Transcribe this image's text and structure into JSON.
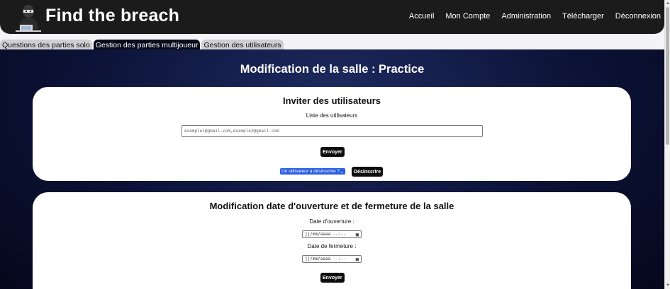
{
  "header": {
    "brand": "Find the breach",
    "nav": [
      "Accueil",
      "Mon Compte",
      "Administration",
      "Télécharger",
      "Déconnexion"
    ]
  },
  "tabs": [
    {
      "label": "Questions des parties solo",
      "active": false
    },
    {
      "label": "Gestion des parties multijoueur",
      "active": true
    },
    {
      "label": "Gestion des utilisateurs",
      "active": false
    }
  ],
  "page_title": "Modification de la salle : Practice",
  "invite": {
    "title": "Inviter des utilisateurs",
    "users_label": "Liste des utilisateurs",
    "users_placeholder": "example1@gmail.com,example2@gmail.com",
    "send_label": "Envoyer",
    "unsubscribe_select": "Un utilisateur à désinscrire ?",
    "unsubscribe_label": "Désinscrire"
  },
  "dates": {
    "title": "Modification date d'ouverture et de fermeture de la salle",
    "open_label": "Date d'ouverture :",
    "open_value": "jj/mm/aaaa --:--",
    "close_label": "Date de fermeture :",
    "close_value": "jj/mm/aaaa --:--",
    "send_label": "Envoyer"
  },
  "colors": {
    "header_bg": "#1b1b1b",
    "main_bg": "#0c1236",
    "select_accent": "#2a5ee0"
  }
}
